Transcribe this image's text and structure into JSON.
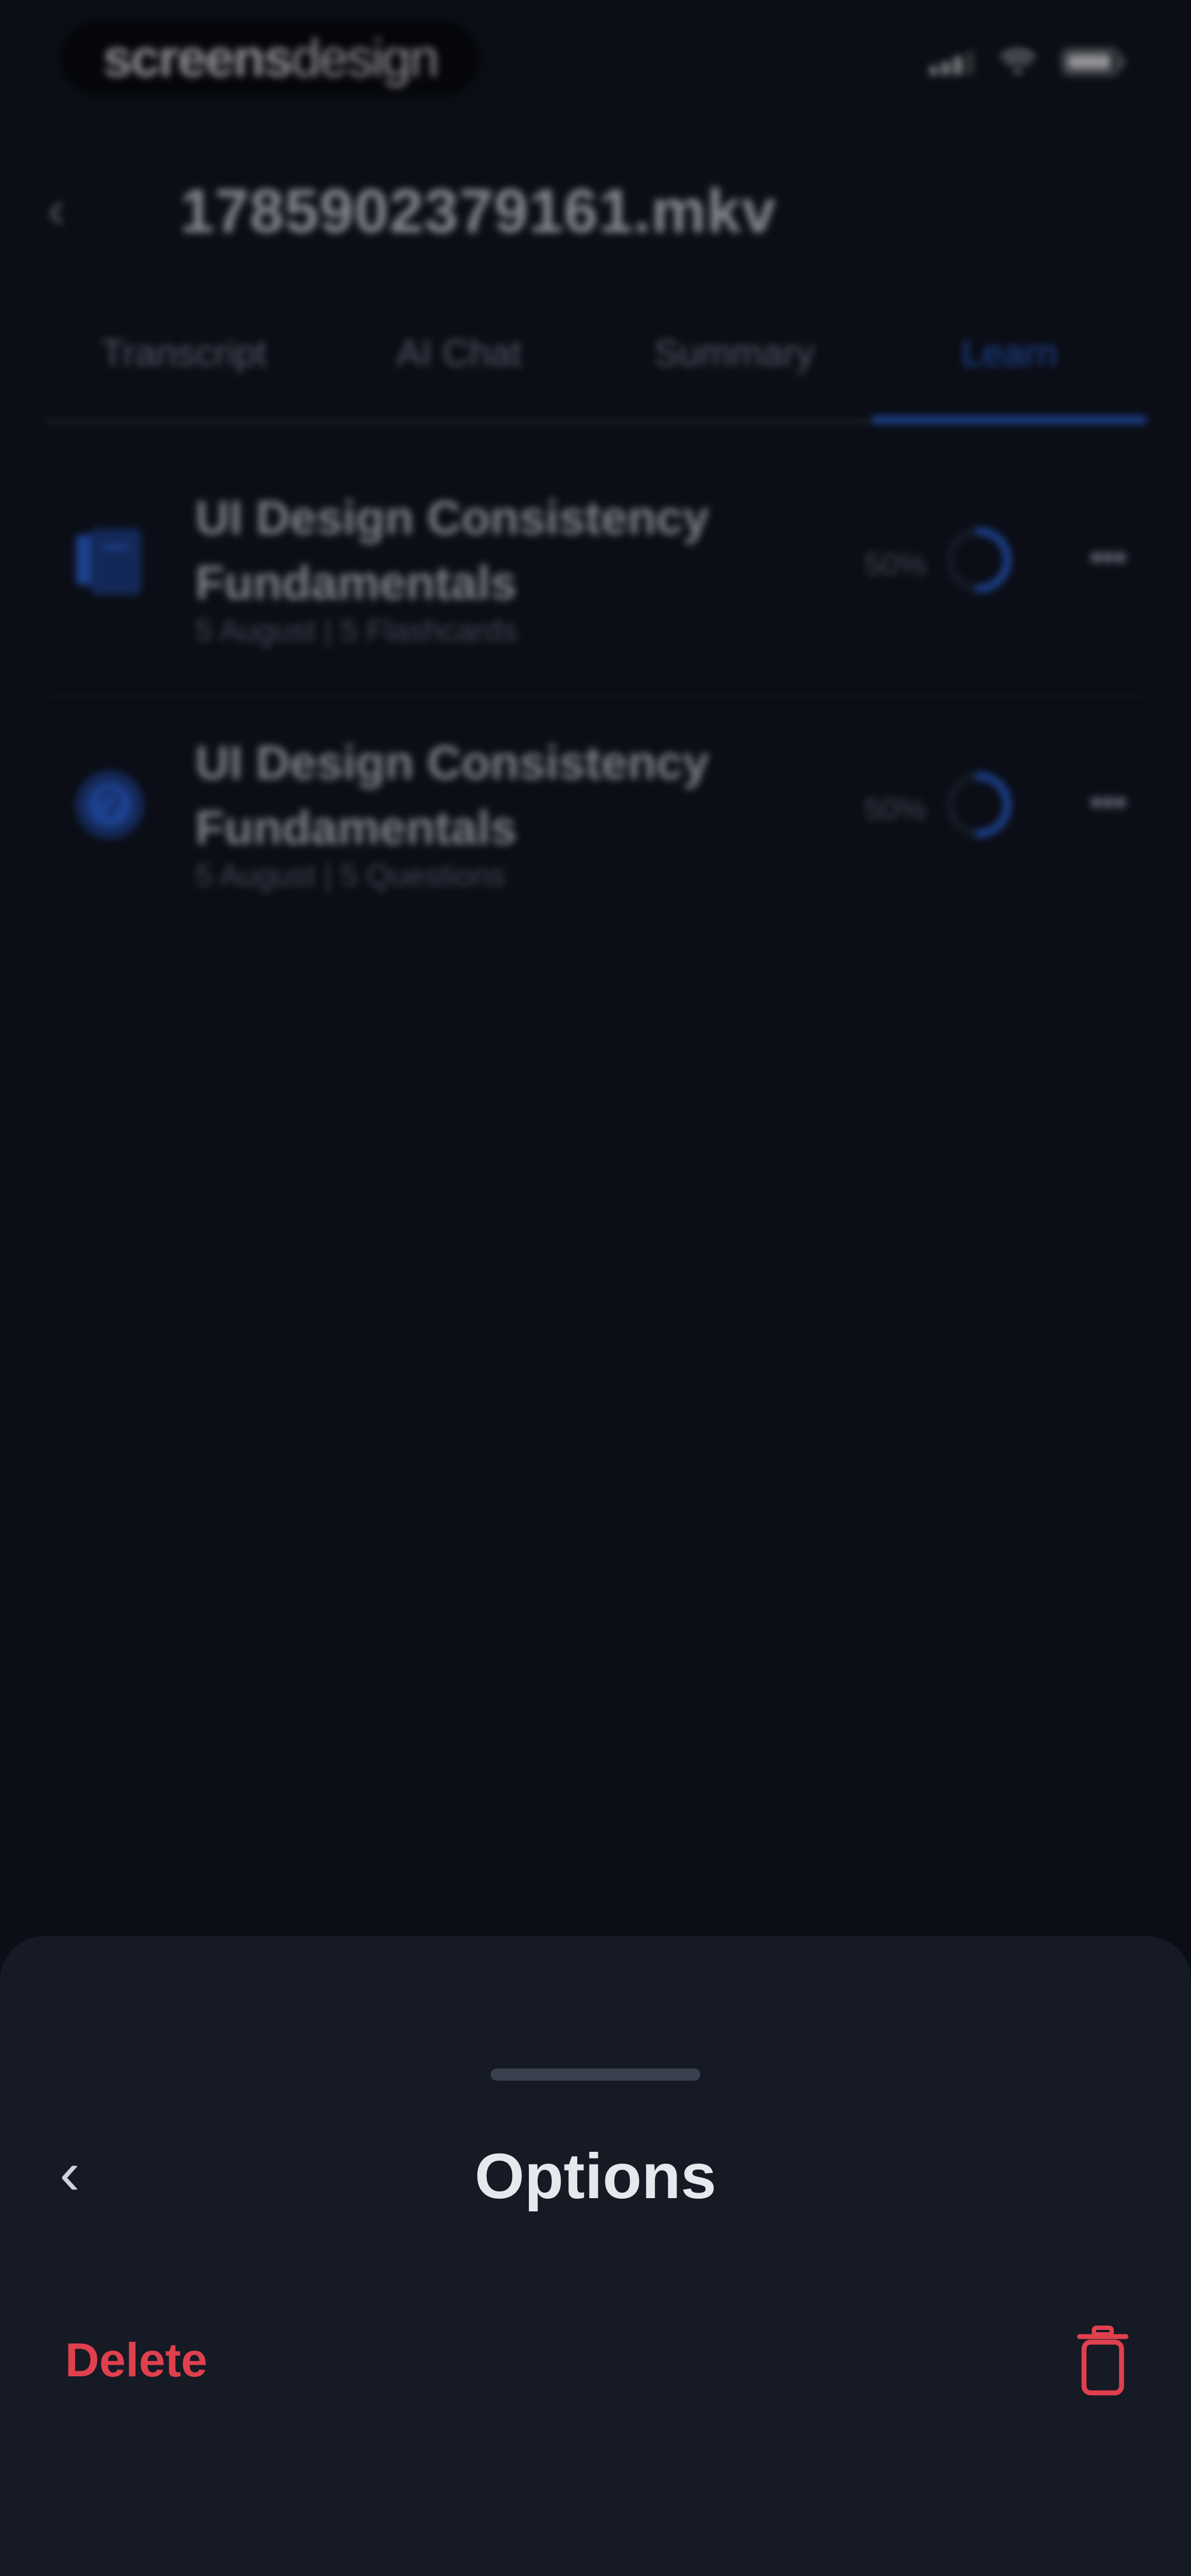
{
  "status_bar": {
    "brand_bold": "screens",
    "brand_light": "design"
  },
  "header": {
    "back_icon": "chevron-left-icon",
    "title": "1785902379161.mkv"
  },
  "tabs": [
    {
      "label": "Transcript",
      "active": false
    },
    {
      "label": "AI Chat",
      "active": false
    },
    {
      "label": "Summary",
      "active": false
    },
    {
      "label": "Learn",
      "active": true
    }
  ],
  "learn_items": [
    {
      "icon": "flashcards-icon",
      "title_line1": "UI Design Consistency",
      "title_line2": "Fundamentals",
      "meta": "5 August | 5 Flashcards",
      "percent": "50%",
      "progress": 0.5
    },
    {
      "icon": "quiz-icon",
      "title_line1": "UI Design Consistency",
      "title_line2": "Fundamentals",
      "meta": "5 August | 5 Questions",
      "percent": "50%",
      "progress": 0.5
    }
  ],
  "sheet": {
    "title": "Options",
    "back_icon": "chevron-left-icon",
    "delete_label": "Delete",
    "delete_icon": "trash-icon"
  },
  "colors": {
    "background": "#0b0e16",
    "accent": "#2d6df6",
    "danger": "#e0404e",
    "sheet": "#151a24"
  }
}
